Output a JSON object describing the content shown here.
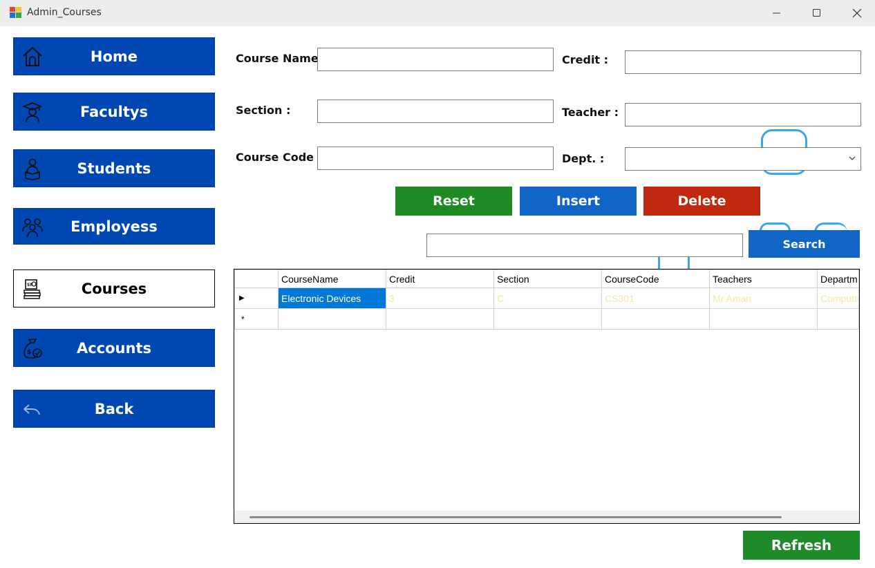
{
  "window": {
    "title": "Admin_Courses",
    "controls": [
      "minimize",
      "maximize",
      "close"
    ]
  },
  "nav": {
    "home": "Home",
    "facultys": "Facultys",
    "students": "Students",
    "employess": "Employess",
    "courses": "Courses",
    "accounts": "Accounts",
    "back": "Back",
    "active": "Courses"
  },
  "form": {
    "course_name_label": "Course Name",
    "course_name_value": "",
    "credit_label": "Credit :",
    "credit_value": "",
    "section_label": "Section :",
    "section_value": "",
    "teacher_label": "Teacher :",
    "teacher_value": "",
    "course_code_label": "Course Code :",
    "course_code_value": "",
    "dept_label": "Dept. :",
    "dept_value": ""
  },
  "actions": {
    "reset": "Reset",
    "insert": "Insert",
    "delete": "Delete",
    "search": "Search",
    "refresh": "Refresh",
    "search_value": ""
  },
  "table": {
    "columns": [
      "CourseName",
      "Credit",
      "Section",
      "CourseCode",
      "Teachers",
      "Departm"
    ],
    "rows": [
      [
        "Electronic Devices",
        "3",
        "C",
        "CS301",
        "Mr Aman",
        "Computer"
      ]
    ],
    "current_row_marker": "▶",
    "new_row_marker": "*"
  },
  "colors": {
    "nav_blue": "#0047b3",
    "reset_green": "#1f8a24",
    "insert_blue": "#0f66c7",
    "delete_red": "#c02810",
    "refresh_green": "#1e8a2a",
    "selection_blue": "#0078d7"
  },
  "icons": {
    "home": "house-icon",
    "facultys": "graduate-icon",
    "students": "student-reading-icon",
    "employess": "people-group-icon",
    "courses": "books-stack-icon",
    "accounts": "money-bag-icon",
    "back": "back-arrow-icon"
  }
}
